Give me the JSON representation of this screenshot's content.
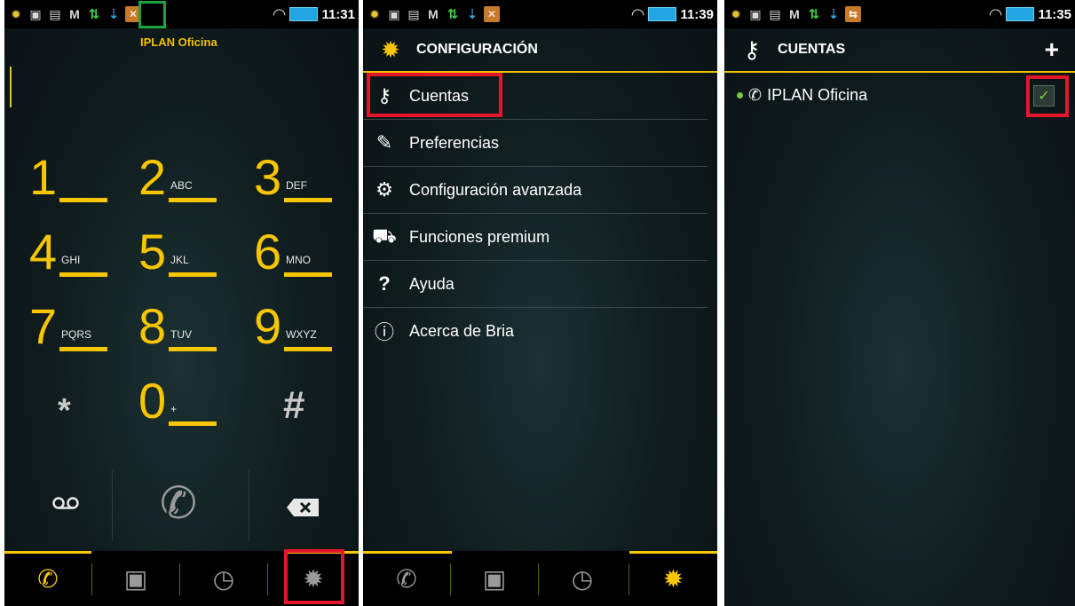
{
  "status_bars": [
    {
      "time": "11:31"
    },
    {
      "time": "11:39"
    },
    {
      "time": "11:35"
    }
  ],
  "dialer": {
    "account_label": "IPLAN Oficina",
    "keys": [
      {
        "digit": "1",
        "letters": ""
      },
      {
        "digit": "2",
        "letters": "ABC"
      },
      {
        "digit": "3",
        "letters": "DEF"
      },
      {
        "digit": "4",
        "letters": "GHI"
      },
      {
        "digit": "5",
        "letters": "JKL"
      },
      {
        "digit": "6",
        "letters": "MNO"
      },
      {
        "digit": "7",
        "letters": "PQRS"
      },
      {
        "digit": "8",
        "letters": "TUV"
      },
      {
        "digit": "9",
        "letters": "WXYZ"
      },
      {
        "digit": "0",
        "letters": "+"
      }
    ],
    "star": "*",
    "hash": "#"
  },
  "settings": {
    "title": "CONFIGURACIÓN",
    "items": [
      {
        "label": "Cuentas",
        "icon": "key-icon"
      },
      {
        "label": "Preferencias",
        "icon": "wrench-icon"
      },
      {
        "label": "Configuración avanzada",
        "icon": "gears-icon"
      },
      {
        "label": "Funciones premium",
        "icon": "cart-icon"
      },
      {
        "label": "Ayuda",
        "icon": "help-icon"
      },
      {
        "label": "Acerca de Bria",
        "icon": "info-icon"
      }
    ]
  },
  "accounts": {
    "title": "CUENTAS",
    "add_symbol": "+",
    "items": [
      {
        "name": "IPLAN Oficina",
        "enabled": true
      }
    ]
  },
  "colors": {
    "accent": "#f7c600",
    "highlight_red": "#e5152a",
    "highlight_green": "#1ba43e"
  }
}
